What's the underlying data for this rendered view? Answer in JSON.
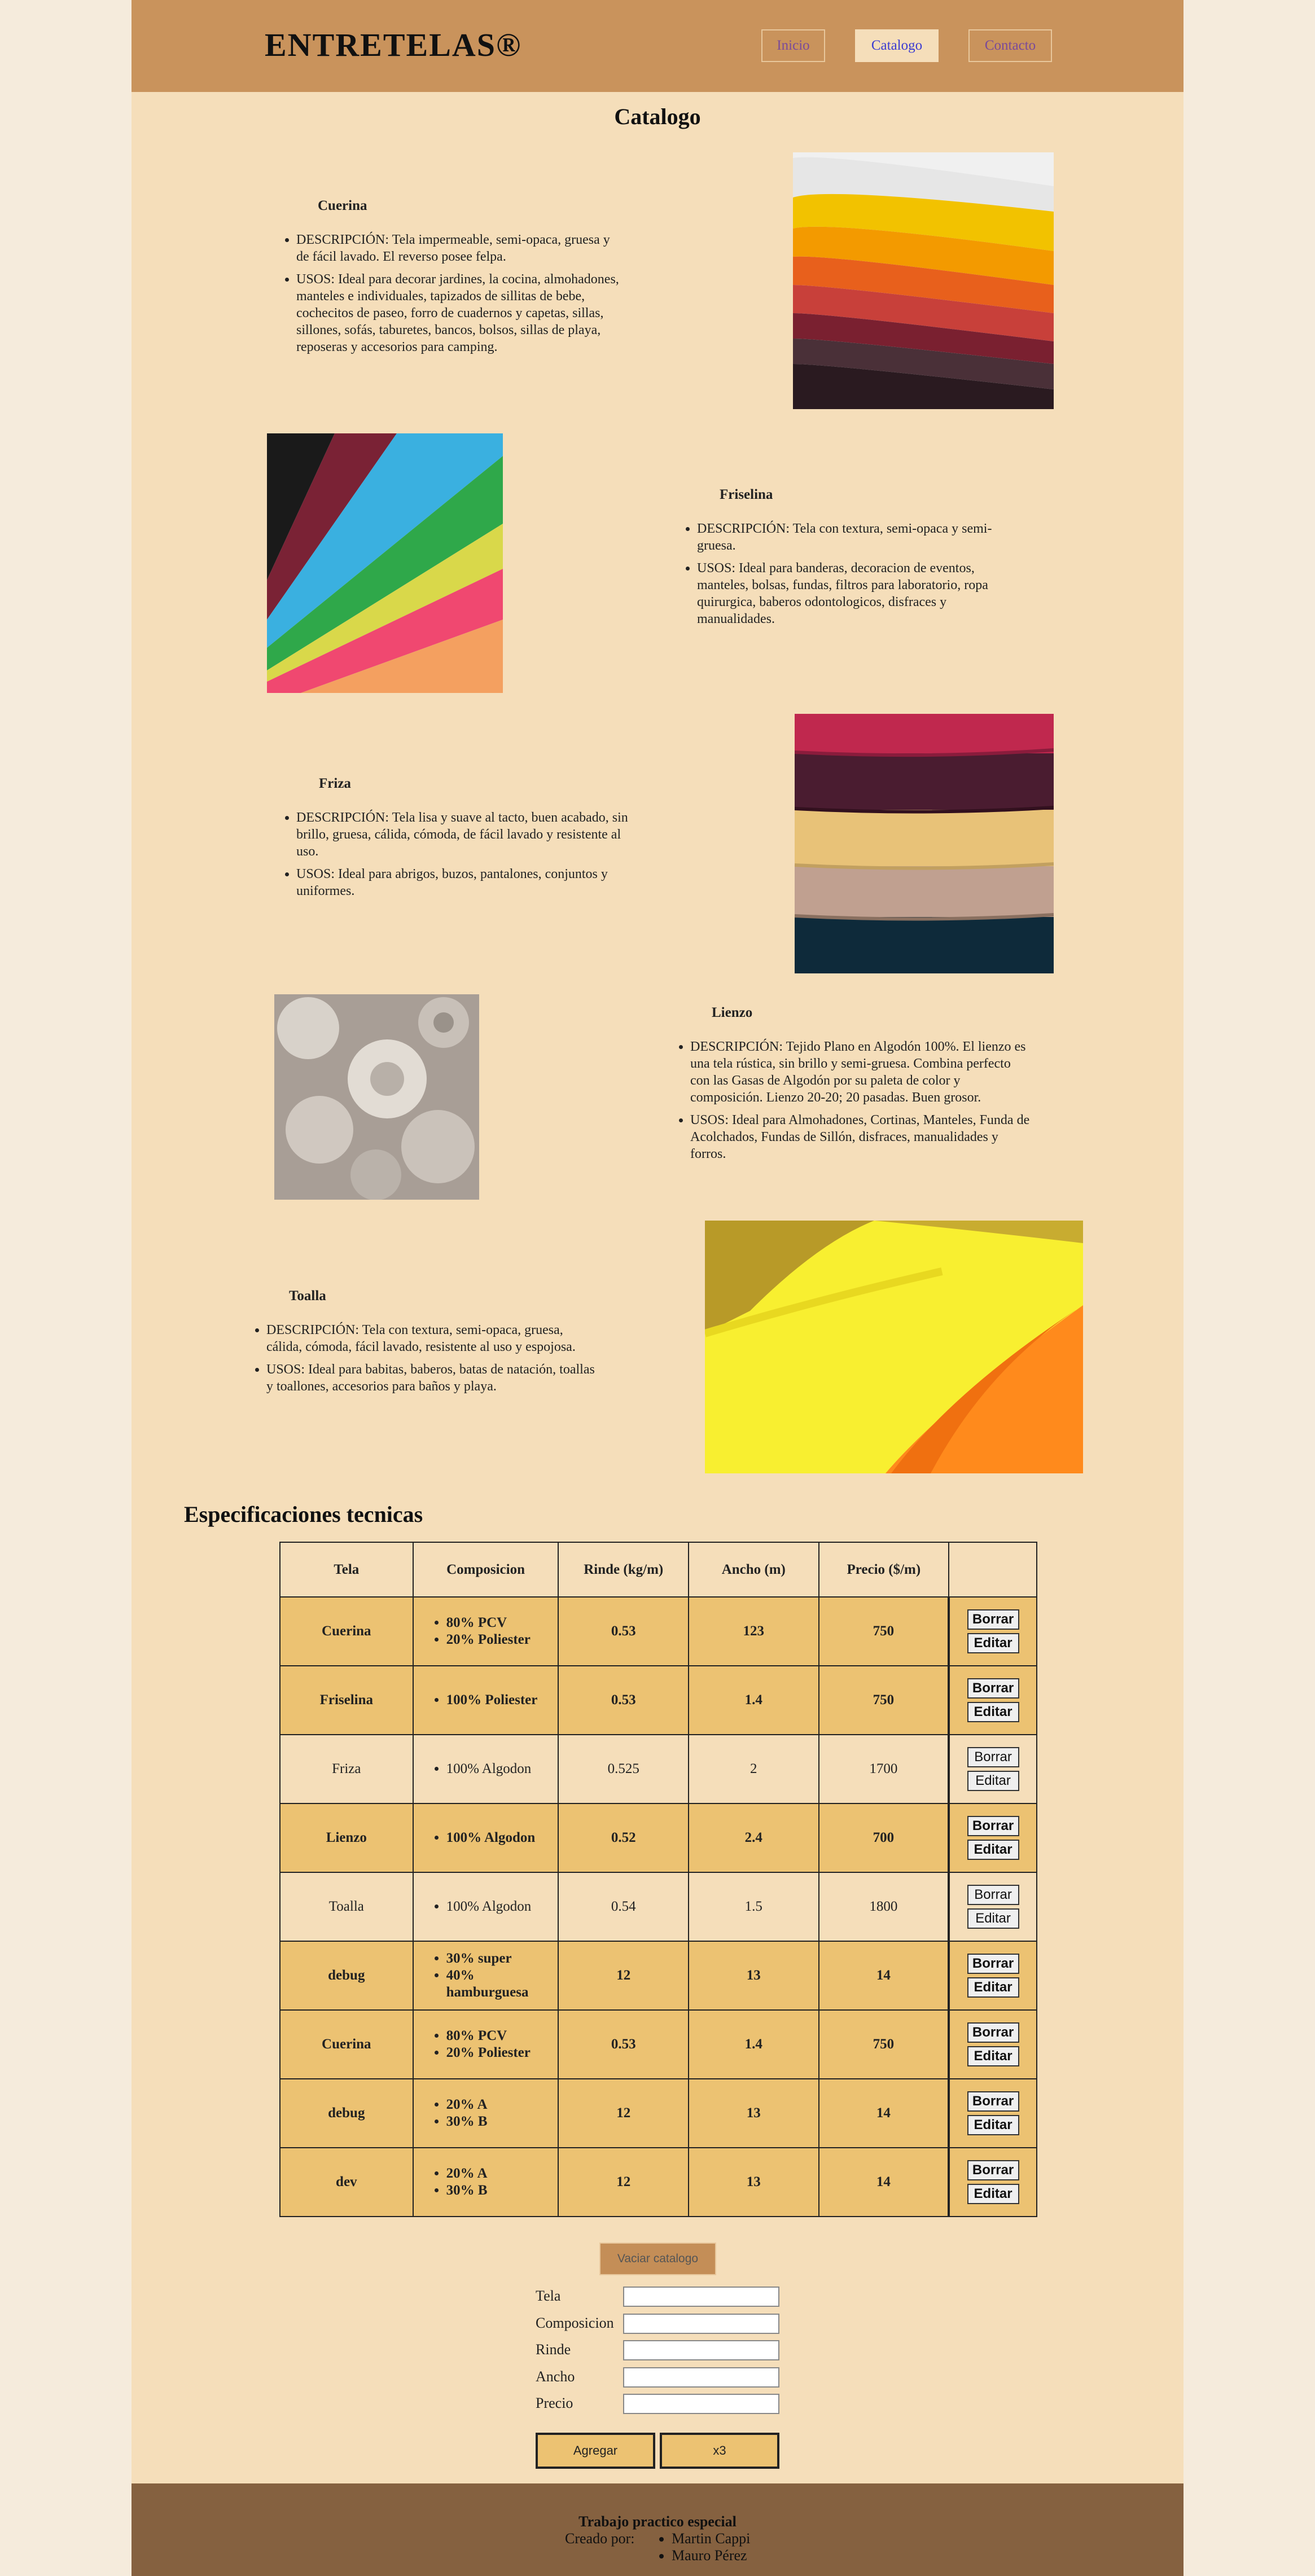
{
  "header": {
    "brand": "ENTRETELAS®",
    "nav": [
      "Inicio",
      "Catalogo",
      "Contacto"
    ]
  },
  "catalog": {
    "title": "Catalogo",
    "products": [
      {
        "name": "Cuerina",
        "description": "DESCRIPCIÓN: Tela impermeable, semi-opaca, gruesa y de fácil lavado. El reverso posee felpa.",
        "uses": "USOS: Ideal para decorar jardines, la cocina, almohadones, manteles e individuales, tapizados de sillitas de bebe, cochecitos de paseo, forro de cuadernos y capetas, sillas, sillones, sofás, taburetes, bancos, bolsos, sillas de playa, reposeras y accesorios para camping."
      },
      {
        "name": "Friselina",
        "description": "DESCRIPCIÓN: Tela con textura, semi-opaca y semi-gruesa.",
        "uses": "USOS: Ideal para banderas, decoracion de eventos, manteles, bolsas, fundas, filtros para laboratorio, ropa quirurgica, baberos odontologicos, disfraces y manualidades."
      },
      {
        "name": "Friza",
        "description": "DESCRIPCIÓN: Tela lisa y suave al tacto, buen acabado, sin brillo, gruesa, cálida, cómoda, de fácil lavado y resistente al uso.",
        "uses": "USOS: Ideal para abrigos, buzos, pantalones, conjuntos y uniformes."
      },
      {
        "name": "Lienzo",
        "description": "DESCRIPCIÓN: Tejido Plano en Algodón 100%. El lienzo es una tela rústica, sin brillo y semi-gruesa. Combina perfecto con las Gasas de Algodón por su paleta de color y composición. Lienzo 20-20; 20 pasadas. Buen grosor.",
        "uses": "USOS: Ideal para Almohadones, Cortinas, Manteles, Funda de Acolchados, Fundas de Sillón, disfraces, manualidades y forros."
      },
      {
        "name": "Toalla",
        "description": "DESCRIPCIÓN: Tela con textura, semi-opaca, gruesa, cálida, cómoda, fácil lavado, resistente al uso y espojosa.",
        "uses": "USOS: Ideal para babitas, baberos, batas de natación, toallas y toallones, accesorios para baños y playa."
      }
    ]
  },
  "specs": {
    "title": "Especificaciones tecnicas",
    "headers": [
      "Tela",
      "Composicion",
      "Rinde (kg/m)",
      "Ancho (m)",
      "Precio ($/m)",
      ""
    ],
    "delete_label": "Borrar",
    "edit_label": "Editar",
    "rows": [
      {
        "tela": "Cuerina",
        "comp": [
          "80% PCV",
          "20% Poliester"
        ],
        "rinde": "0.53",
        "ancho": "123",
        "precio": "750"
      },
      {
        "tela": "Friselina",
        "comp": [
          "100% Poliester"
        ],
        "rinde": "0.53",
        "ancho": "1.4",
        "precio": "750"
      },
      {
        "tela": "Friza",
        "comp": [
          "100% Algodon"
        ],
        "rinde": "0.525",
        "ancho": "2",
        "precio": "1700"
      },
      {
        "tela": "Lienzo",
        "comp": [
          "100% Algodon"
        ],
        "rinde": "0.52",
        "ancho": "2.4",
        "precio": "700"
      },
      {
        "tela": "Toalla",
        "comp": [
          "100% Algodon"
        ],
        "rinde": "0.54",
        "ancho": "1.5",
        "precio": "1800"
      },
      {
        "tela": "debug",
        "comp": [
          "30% super",
          "40% hamburguesa"
        ],
        "rinde": "12",
        "ancho": "13",
        "precio": "14"
      },
      {
        "tela": "Cuerina",
        "comp": [
          "80% PCV",
          "20% Poliester"
        ],
        "rinde": "0.53",
        "ancho": "1.4",
        "precio": "750"
      },
      {
        "tela": "debug",
        "comp": [
          "20% A",
          "30% B"
        ],
        "rinde": "12",
        "ancho": "13",
        "precio": "14"
      },
      {
        "tela": "dev",
        "comp": [
          "20% A",
          "30% B"
        ],
        "rinde": "12",
        "ancho": "13",
        "precio": "14"
      }
    ]
  },
  "form": {
    "clear_label": "Vaciar catalogo",
    "labels": [
      "Tela",
      "Composicion",
      "Rinde",
      "Ancho",
      "Precio"
    ],
    "add_label": "Agregar",
    "x3_label": "x3"
  },
  "footer": {
    "title": "Trabajo practico especial",
    "created_by": "Creado por:",
    "authors": [
      "Martin Cappi",
      "Mauro Pérez"
    ]
  }
}
